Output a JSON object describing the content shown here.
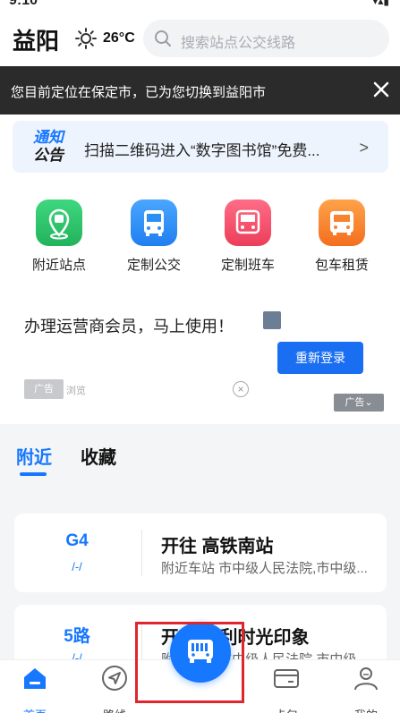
{
  "status": {
    "time": "9:10"
  },
  "header": {
    "city": "益阳",
    "weather_icon": "sun-icon",
    "temperature": "26°C",
    "search_placeholder": "搜索站点公交线路"
  },
  "toast": {
    "message": "您目前定位在保定市，已为您切换到益阳市"
  },
  "notice": {
    "tag_line1": "通知",
    "tag_line2": "公告",
    "text": "扫描二维码进入“数字图书馆”免费..."
  },
  "services": [
    {
      "label": "附近站点",
      "icon": "nearby-stop-icon",
      "color": "#2fc06a"
    },
    {
      "label": "定制公交",
      "icon": "custom-bus-icon",
      "color": "#2b8ef5"
    },
    {
      "label": "定制班车",
      "icon": "custom-shuttle-icon",
      "color": "#f0506a"
    },
    {
      "label": "包车租赁",
      "icon": "charter-bus-icon",
      "color": "#f6832f"
    }
  ],
  "ad": {
    "headline": "办理运营商会员，马上使用！",
    "login_button": "重新登录",
    "ad_tag": "广告",
    "browse": "浏览",
    "ad_badge": "广告"
  },
  "tabs": {
    "nearby": "附近",
    "favorites": "收藏"
  },
  "cards": [
    {
      "route": "G4",
      "eta": "/-/",
      "destination": "开往 高铁南站",
      "nearby_stop": "附近车站 市中级人民法院,市中级..."
    },
    {
      "route": "5路",
      "eta": "/-/",
      "destination": "开往 保利时光印象",
      "nearby_stop": "附近车站 市中级人民法院,市中级..."
    }
  ],
  "nav": {
    "home": "首页",
    "routes": "路线",
    "wallet": "卡包",
    "mine": "我的"
  }
}
